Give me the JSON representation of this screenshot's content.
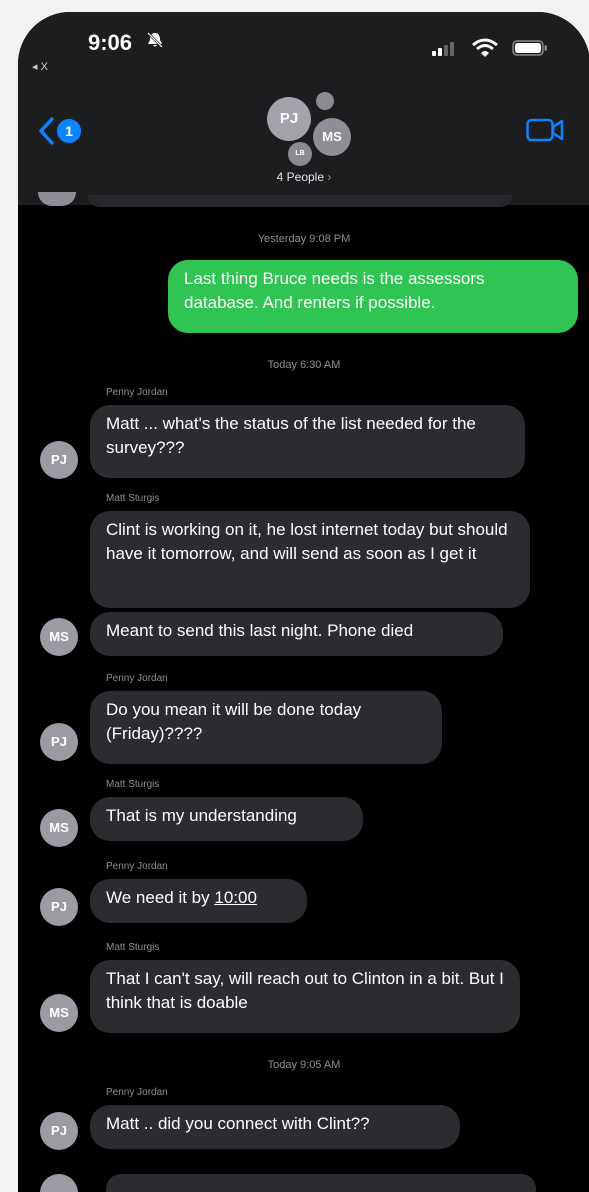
{
  "status_bar": {
    "time": "9:06",
    "back_app": "◂ X"
  },
  "header": {
    "back_badge": "1",
    "avatars": {
      "pj": "PJ",
      "ms": "MS",
      "lb": "LB"
    },
    "people_label": "4 People",
    "people_chevron": "›"
  },
  "thread": {
    "timestamps": [
      "Yesterday 9:08 PM",
      "Today 6:30 AM",
      "Today 9:05 AM"
    ],
    "outgoing": [
      "Last thing Bruce needs is the assessors database. And renters if possible."
    ],
    "messages": [
      {
        "sender": "Penny Jordan",
        "avatar": "PJ",
        "text": "Matt ... what's the status of the list needed for the survey???"
      },
      {
        "sender": "Matt Sturgis",
        "avatar": "MS",
        "text": "Clint is working on it, he lost internet today but should have it tomorrow, and will send as soon as I get it"
      },
      {
        "sender": "",
        "avatar": "",
        "text": "Meant to send this last night. Phone died"
      },
      {
        "sender": "Penny Jordan",
        "avatar": "PJ",
        "text": "Do you mean it will be done today (Friday)????"
      },
      {
        "sender": "Matt Sturgis",
        "avatar": "MS",
        "text": "That is my understanding"
      },
      {
        "sender": "Penny Jordan",
        "avatar": "PJ",
        "text_prefix": "We need it by ",
        "text_link": "10:00"
      },
      {
        "sender": "Matt Sturgis",
        "avatar": "MS",
        "text": "That I can't say, will reach out to Clinton in a bit. But I think that is doable"
      },
      {
        "sender": "Penny Jordan",
        "avatar": "PJ",
        "text": "Matt ..  did you connect with Clint??"
      }
    ]
  },
  "colors": {
    "outgoing_bubble": "#30c553",
    "incoming_bubble": "#2b2c30",
    "accent": "#0a84ff"
  },
  "icons": [
    "bell-muted-icon",
    "signal-icon",
    "wifi-icon",
    "battery-icon",
    "back-chevron-icon",
    "video-camera-icon"
  ]
}
